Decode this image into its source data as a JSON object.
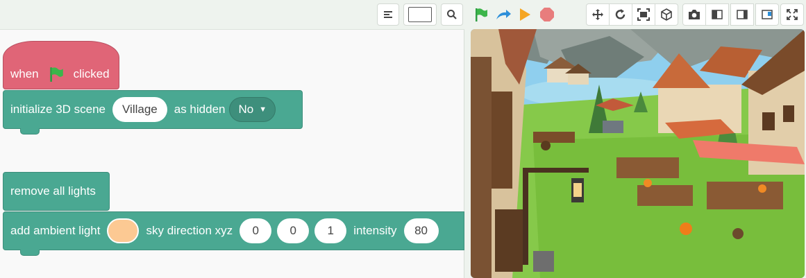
{
  "toolbar": {
    "left_tools": [
      "align-left-icon",
      "zoom-box",
      "search-icon"
    ],
    "run_controls": [
      "green-flag-icon",
      "step-arrow-icon",
      "play-icon",
      "stop-icon"
    ],
    "view_tools": [
      "move-icon",
      "rotate-icon",
      "fit-screen-icon",
      "cube-icon",
      "camera-icon",
      "layout-left-icon",
      "layout-right-icon",
      "layout-top-right-icon",
      "fullscreen-icon"
    ],
    "colors": {
      "flag": "#2f9e44",
      "step": "#2d8fd9",
      "play": "#f5a623",
      "stop": "#e87d7d"
    }
  },
  "blocks": {
    "hat": {
      "when": "when",
      "clicked": "clicked",
      "color": "#e06577"
    },
    "init_scene": {
      "label": "initialize 3D scene",
      "scene": "Village",
      "as_hidden": "as hidden",
      "hidden_value": "No",
      "color": "#4aa892"
    },
    "remove_lights": {
      "label": "remove all lights"
    },
    "ambient": {
      "label": "add ambient light",
      "swatch_color": "#fcc993",
      "sky_label": "sky direction xyz",
      "x": "0",
      "y": "0",
      "z": "1",
      "intensity_label": "intensity",
      "intensity": "80"
    }
  },
  "stage": {
    "scene": "3D medieval village"
  }
}
